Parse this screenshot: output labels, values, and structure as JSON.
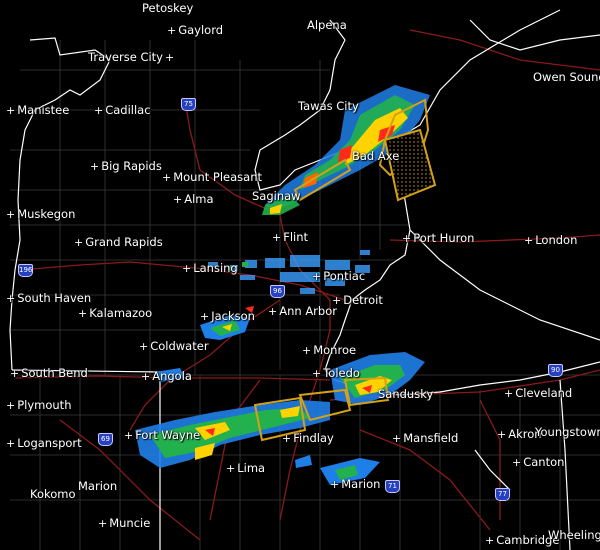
{
  "map": {
    "cities": [
      {
        "id": "petoskey",
        "name": "Petoskey"
      },
      {
        "id": "gaylord",
        "name": "Gaylord"
      },
      {
        "id": "alpena",
        "name": "Alpena"
      },
      {
        "id": "traverse-city",
        "name": "Traverse City"
      },
      {
        "id": "owen-sound",
        "name": "Owen Sound"
      },
      {
        "id": "manistee",
        "name": "Manistee"
      },
      {
        "id": "cadillac",
        "name": "Cadillac"
      },
      {
        "id": "tawas-city",
        "name": "Tawas City"
      },
      {
        "id": "big-rapids",
        "name": "Big Rapids"
      },
      {
        "id": "bad-axe",
        "name": "Bad Axe"
      },
      {
        "id": "mount-pleasant",
        "name": "Mount Pleasant"
      },
      {
        "id": "alma",
        "name": "Alma"
      },
      {
        "id": "saginaw",
        "name": "Saginaw"
      },
      {
        "id": "muskegon",
        "name": "Muskegon"
      },
      {
        "id": "flint",
        "name": "Flint"
      },
      {
        "id": "grand-rapids",
        "name": "Grand Rapids"
      },
      {
        "id": "port-huron",
        "name": "Port Huron"
      },
      {
        "id": "london",
        "name": "London"
      },
      {
        "id": "lansing",
        "name": "Lansing"
      },
      {
        "id": "pontiac",
        "name": "Pontiac"
      },
      {
        "id": "south-haven",
        "name": "South Haven"
      },
      {
        "id": "detroit",
        "name": "Detroit"
      },
      {
        "id": "kalamazoo",
        "name": "Kalamazoo"
      },
      {
        "id": "ann-arbor",
        "name": "Ann Arbor"
      },
      {
        "id": "jackson",
        "name": "Jackson"
      },
      {
        "id": "coldwater",
        "name": "Coldwater"
      },
      {
        "id": "monroe",
        "name": "Monroe"
      },
      {
        "id": "south-bend",
        "name": "South Bend"
      },
      {
        "id": "angola",
        "name": "Angola"
      },
      {
        "id": "toledo",
        "name": "Toledo"
      },
      {
        "id": "sandusky",
        "name": "Sandusky"
      },
      {
        "id": "cleveland",
        "name": "Cleveland"
      },
      {
        "id": "plymouth",
        "name": "Plymouth"
      },
      {
        "id": "fort-wayne",
        "name": "Fort Wayne"
      },
      {
        "id": "findlay",
        "name": "Findlay"
      },
      {
        "id": "akron",
        "name": "Akron"
      },
      {
        "id": "youngstown",
        "name": "Youngstown"
      },
      {
        "id": "logansport",
        "name": "Logansport"
      },
      {
        "id": "lima",
        "name": "Lima"
      },
      {
        "id": "mansfield",
        "name": "Mansfield"
      },
      {
        "id": "canton",
        "name": "Canton"
      },
      {
        "id": "kokomo",
        "name": "Kokomo"
      },
      {
        "id": "marion-in",
        "name": "Marion"
      },
      {
        "id": "marion-oh",
        "name": "Marion"
      },
      {
        "id": "muncie",
        "name": "Muncie"
      },
      {
        "id": "cambridge",
        "name": "Cambridge"
      },
      {
        "id": "wheeling",
        "name": "Wheeling"
      }
    ],
    "interstates": [
      {
        "id": "i75",
        "number": "75"
      },
      {
        "id": "i196",
        "number": "196"
      },
      {
        "id": "i96",
        "number": "96"
      },
      {
        "id": "i69",
        "number": "69"
      },
      {
        "id": "i71",
        "number": "71"
      },
      {
        "id": "i77",
        "number": "77"
      },
      {
        "id": "i90",
        "number": "90"
      }
    ],
    "colors": {
      "background": "#000000",
      "state_border": "#ffffff",
      "county_line": "#3c3c3c",
      "highway": "#8a1a1a",
      "warning_polygon": "#d4a017",
      "radar_light": "#1f7fe8",
      "radar_mid": "#22b14c",
      "radar_heavy": "#ffd200",
      "radar_intense": "#ff2a1a"
    }
  }
}
